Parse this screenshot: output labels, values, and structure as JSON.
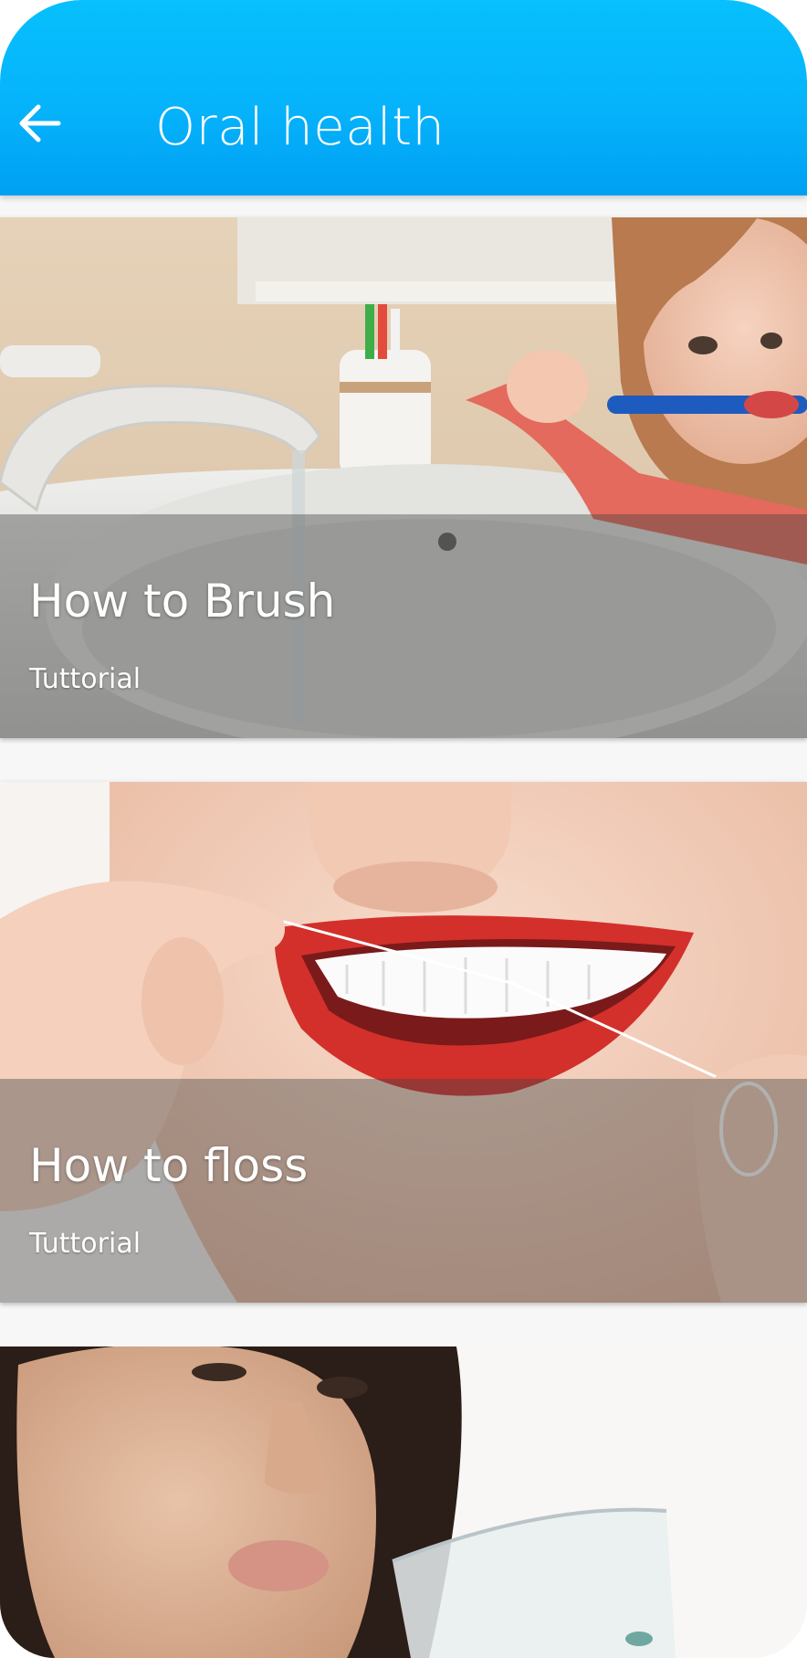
{
  "header": {
    "title": "Oral health",
    "back_icon": "arrow-left-icon",
    "background_color": "#06b3fb"
  },
  "cards": [
    {
      "title": "How to Brush",
      "subtitle": "Tuttorial",
      "image": "child-brushing-teeth-photo"
    },
    {
      "title": "How to floss",
      "subtitle": "Tuttorial",
      "image": "woman-flossing-teeth-photo"
    },
    {
      "image": "woman-rinsing-mouthwash-photo"
    }
  ]
}
